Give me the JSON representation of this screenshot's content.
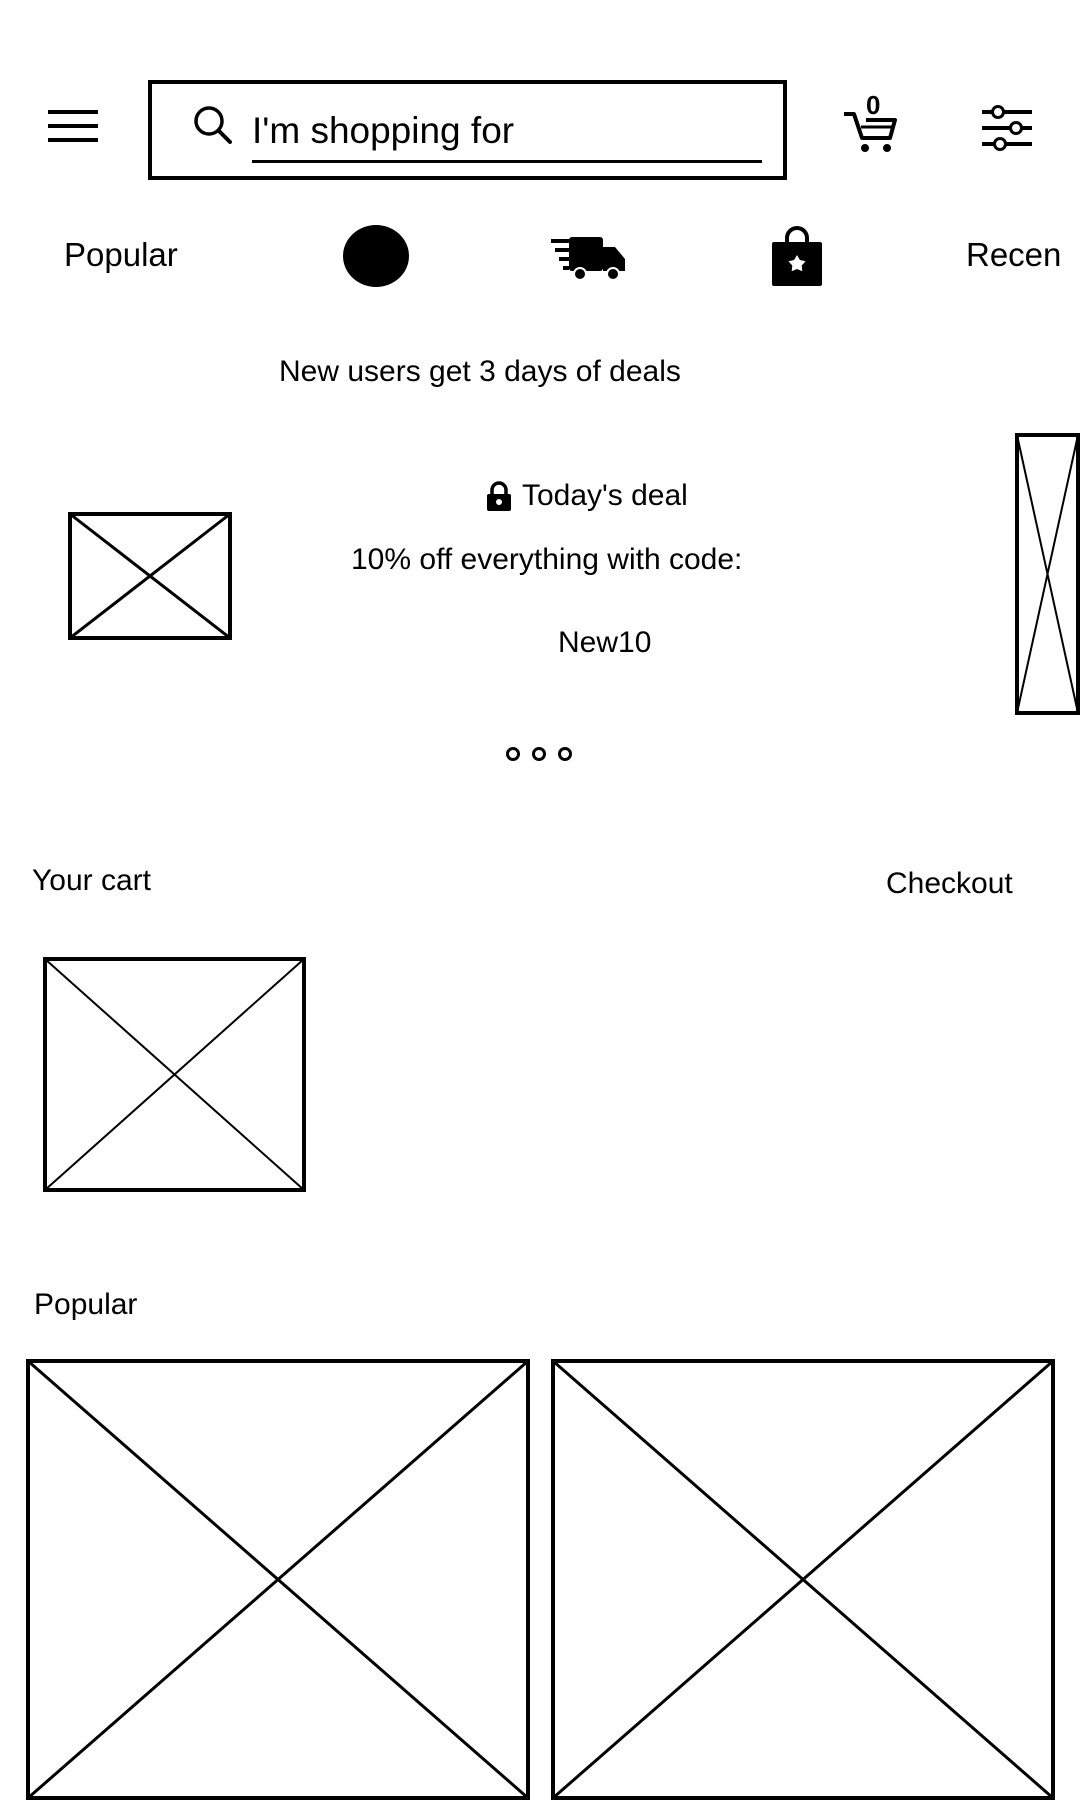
{
  "header": {
    "search": {
      "placeholder": "I'm shopping for",
      "value": ""
    },
    "cart_count": "0",
    "icons": {
      "menu": "menu-icon",
      "search": "search-icon",
      "cart": "cart-icon",
      "filter": "filter-sliders-icon"
    }
  },
  "categories": {
    "popular_label": "Popular",
    "recent_label": "Recen",
    "icons": [
      "circle-icon",
      "fast-delivery-truck-icon",
      "shopping-bag-star-icon"
    ]
  },
  "promo": {
    "headline": "New users get 3 days of deals",
    "deal_title": "Today's deal",
    "deal_text": "10% off everything with code:",
    "code": "New10",
    "icons": {
      "deal": "lock-icon"
    },
    "carousel_dots": 3
  },
  "cart_section": {
    "title": "Your cart",
    "checkout_label": "Checkout"
  },
  "popular_section": {
    "title": "Popular"
  }
}
